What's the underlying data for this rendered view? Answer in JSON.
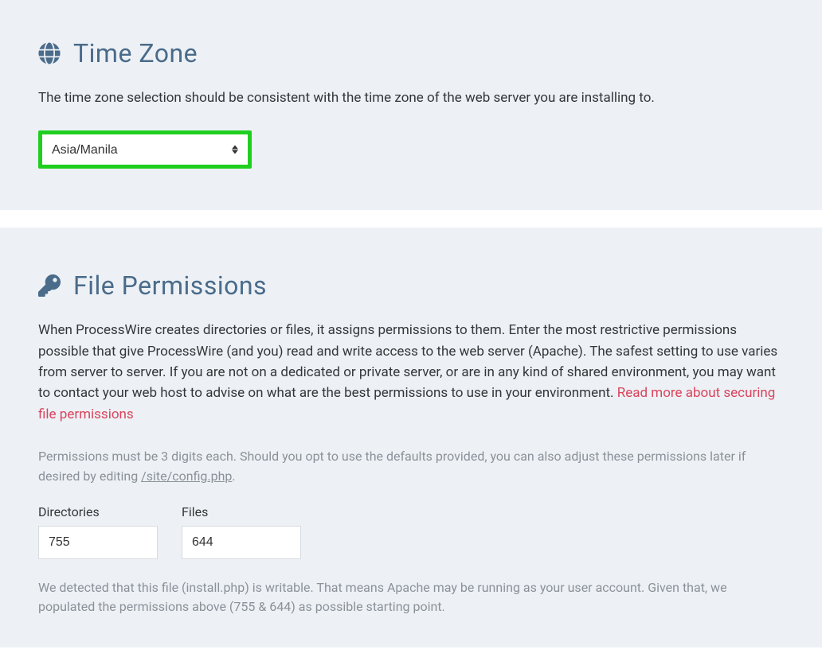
{
  "timezone": {
    "heading": "Time Zone",
    "description": "The time zone selection should be consistent with the time zone of the web server you are installing to.",
    "selected": "Asia/Manila"
  },
  "permissions": {
    "heading": "File Permissions",
    "description_part1": "When ProcessWire creates directories or files, it assigns permissions to them. Enter the most restrictive permissions possible that give ProcessWire (and you) read and write access to the web server (Apache). The safest setting to use varies from server to server. If you are not on a dedicated or private server, or are in any kind of shared environment, you may want to contact your web host to advise on what are the best permissions to use in your environment. ",
    "description_link": "Read more about securing file permissions",
    "note_part1": "Permissions must be 3 digits each. Should you opt to use the defaults provided, you can also adjust these permissions later if desired by editing ",
    "note_path": "/site/config.php",
    "note_part2": ".",
    "dir_label": "Directories",
    "dir_value": "755",
    "files_label": "Files",
    "files_value": "644",
    "detect_note": "We detected that this file (install.php) is writable. That means Apache may be running as your user account. Given that, we populated the permissions above (755 & 644) as possible starting point."
  }
}
